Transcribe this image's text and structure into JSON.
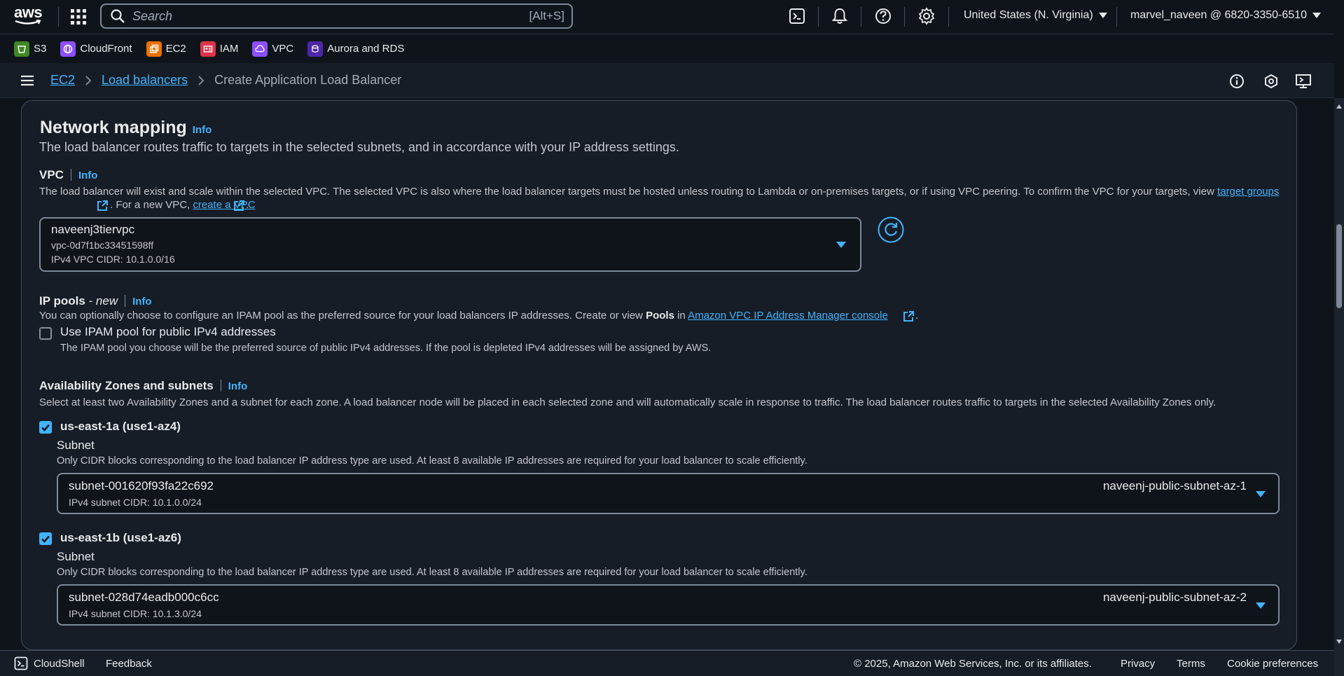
{
  "topnav": {
    "logo_text": "aws",
    "search_placeholder": "Search",
    "search_shortcut": "[Alt+S]",
    "region": "United States (N. Virginia)",
    "account": "marvel_naveen @ 6820-3350-6510"
  },
  "favorites": [
    {
      "label": "S3",
      "color": "#3f8624",
      "icon": "s3-icon"
    },
    {
      "label": "CloudFront",
      "color": "#8c4fff",
      "icon": "cloudfront-icon"
    },
    {
      "label": "EC2",
      "color": "#ed7100",
      "icon": "ec2-icon"
    },
    {
      "label": "IAM",
      "color": "#dd344c",
      "icon": "iam-icon"
    },
    {
      "label": "VPC",
      "color": "#8c4fff",
      "icon": "vpc-icon"
    },
    {
      "label": "Aurora and RDS",
      "color": "#4d27aa",
      "icon": "rds-icon"
    }
  ],
  "breadcrumb": {
    "items": [
      "EC2",
      "Load balancers"
    ],
    "current": "Create Application Load Balancer"
  },
  "network_mapping": {
    "title": "Network mapping",
    "info": "Info",
    "description": "The load balancer routes traffic to targets in the selected subnets, and in accordance with your IP address settings.",
    "vpc": {
      "label": "VPC",
      "info": "Info",
      "desc_part1": "The load balancer will exist and scale within the selected VPC. The selected VPC is also where the load balancer targets must be hosted unless routing to Lambda or on-premises targets, or if using VPC peering. To confirm the VPC for your targets, view ",
      "link_target_groups_1": "target",
      "link_target_groups_2": "groups",
      "desc_part2": ". For a new VPC, ",
      "link_create_vpc": "create a VPC",
      "desc_part3": ".",
      "selected_name": "naveenj3tiervpc",
      "selected_id": "vpc-0d7f1bc33451598ff",
      "selected_cidr": "IPv4 VPC CIDR: 10.1.0.0/16"
    },
    "ip_pools": {
      "label": "IP pools",
      "label_suffix": " - new",
      "info": "Info",
      "desc_part1": "You can optionally choose to configure an IPAM pool as the preferred source for your load balancers IP addresses. Create or view ",
      "desc_bold": "Pools",
      "desc_part2": " in ",
      "link_ipam": "Amazon VPC IP Address Manager console",
      "desc_part3": ".",
      "checkbox_label": "Use IPAM pool for public IPv4 addresses",
      "checkbox_checked": false,
      "checkbox_desc": "The IPAM pool you choose will be the preferred source of public IPv4 addresses. If the pool is depleted IPv4 addresses will be assigned by AWS."
    },
    "az": {
      "label": "Availability Zones and subnets",
      "info": "Info",
      "desc": "Select at least two Availability Zones and a subnet for each zone. A load balancer node will be placed in each selected zone and will automatically scale in response to traffic. The load balancer routes traffic to targets in the selected Availability Zones only.",
      "zones": [
        {
          "name": "us-east-1a (use1-az4)",
          "checked": true,
          "subnet_label": "Subnet",
          "subnet_desc": "Only CIDR blocks corresponding to the load balancer IP address type are used. At least 8 available IP addresses are required for your load balancer to scale efficiently.",
          "subnet_id": "subnet-001620f93fa22c692",
          "subnet_cidr": "IPv4 subnet CIDR: 10.1.0.0/24",
          "subnet_name": "naveenj-public-subnet-az-1"
        },
        {
          "name": "us-east-1b (use1-az6)",
          "checked": true,
          "subnet_label": "Subnet",
          "subnet_desc": "Only CIDR blocks corresponding to the load balancer IP address type are used. At least 8 available IP addresses are required for your load balancer to scale efficiently.",
          "subnet_id": "subnet-028d74eadb000c6cc",
          "subnet_cidr": "IPv4 subnet CIDR: 10.1.3.0/24",
          "subnet_name": "naveenj-public-subnet-az-2"
        }
      ]
    }
  },
  "footer": {
    "cloudshell": "CloudShell",
    "feedback": "Feedback",
    "copyright": "© 2025, Amazon Web Services, Inc. or its affiliates.",
    "privacy": "Privacy",
    "terms": "Terms",
    "cookies": "Cookie preferences"
  }
}
